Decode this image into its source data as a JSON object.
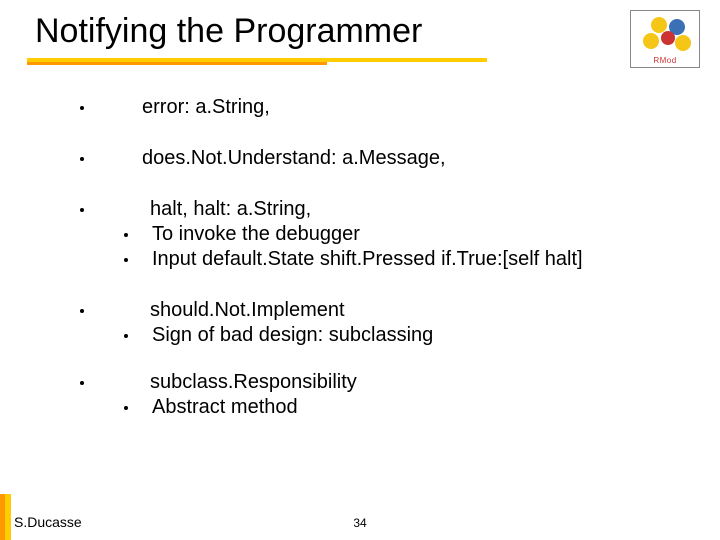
{
  "title": "Notifying the Programmer",
  "logo_label": "RMod",
  "bullets": {
    "b1": " error: a.String,",
    "b2": " does.Not.Understand: a.Message,",
    "b3": {
      "head": " halt,  halt: a.String,",
      "sub1": "To invoke the debugger",
      "sub2": "Input default.State shift.Pressed if.True:[self halt]"
    },
    "b4": {
      "head": " should.Not.Implement",
      "sub1": "Sign of bad design: subclassing"
    },
    "b5": {
      "head": " subclass.Responsibility",
      "sub1": "Abstract method"
    }
  },
  "author": "S.Ducasse",
  "page_number": "34"
}
